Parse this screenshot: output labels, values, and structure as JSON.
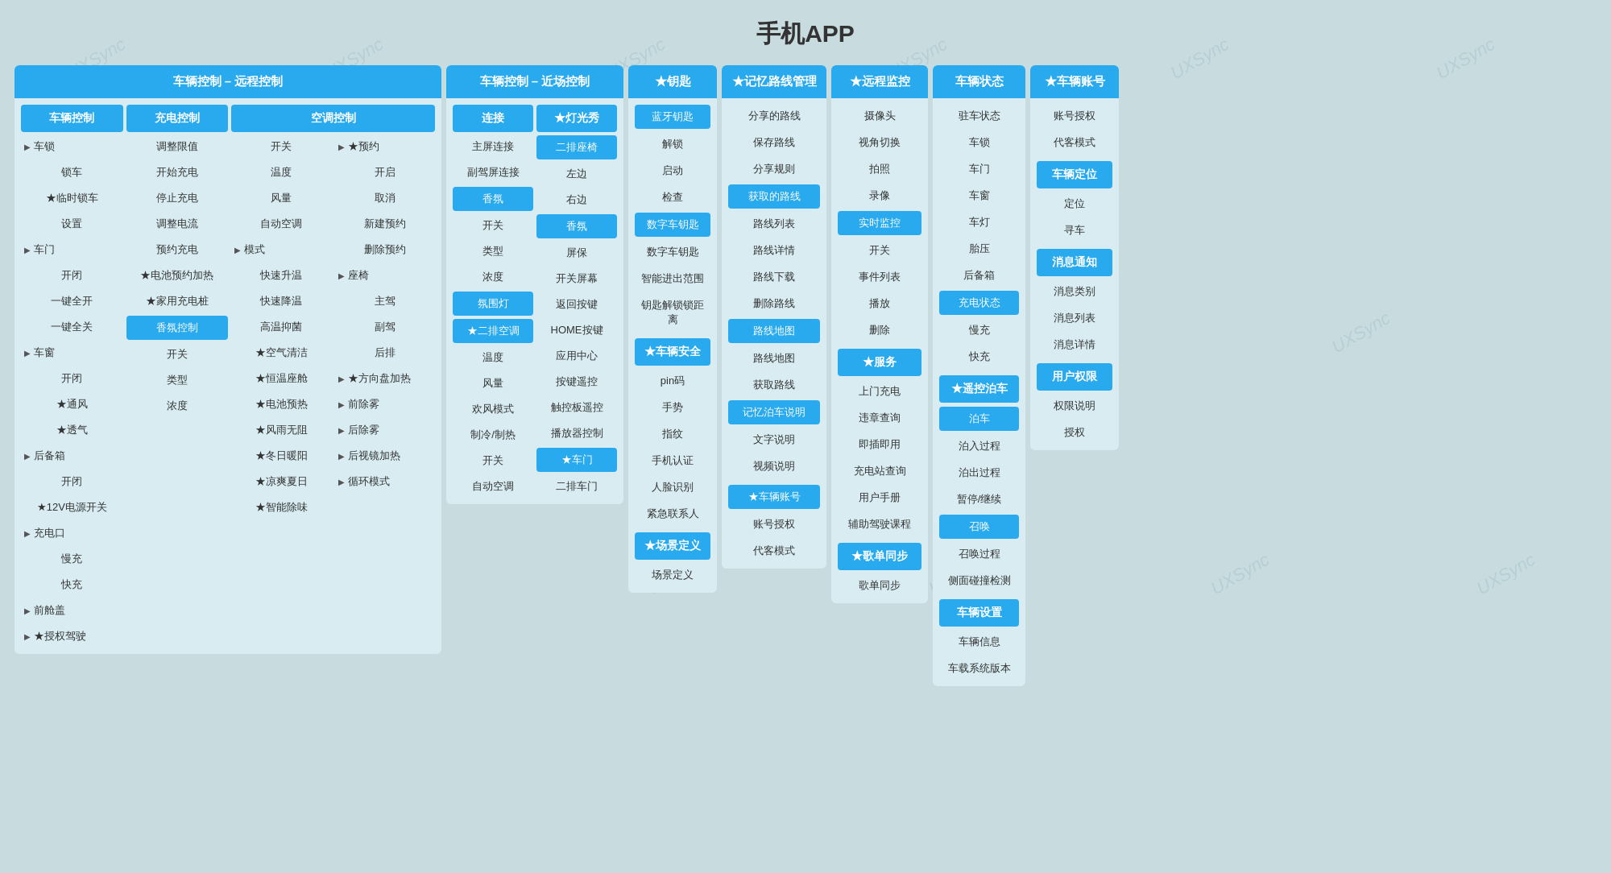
{
  "page": {
    "title": "手机APP"
  },
  "remote_control": {
    "title": "车辆控制 – 远程控制",
    "vehicle_ctrl": {
      "header": "车辆控制",
      "items": [
        {
          "label": "车锁",
          "type": "arrow-group"
        },
        {
          "label": "锁车",
          "type": "item"
        },
        {
          "label": "★临时锁车",
          "type": "item"
        },
        {
          "label": "设置",
          "type": "item"
        },
        {
          "label": "车门",
          "type": "arrow-group"
        },
        {
          "label": "开闭",
          "type": "item"
        },
        {
          "label": "一键全开",
          "type": "item"
        },
        {
          "label": "一键全关",
          "type": "item"
        },
        {
          "label": "车窗",
          "type": "arrow-group"
        },
        {
          "label": "开闭",
          "type": "item"
        },
        {
          "label": "★通风",
          "type": "item"
        },
        {
          "label": "★透气",
          "type": "item"
        },
        {
          "label": "后备箱",
          "type": "arrow-group"
        },
        {
          "label": "开闭",
          "type": "item"
        },
        {
          "label": "★12V电源开关",
          "type": "item"
        },
        {
          "label": "充电口",
          "type": "arrow-group"
        },
        {
          "label": "慢充",
          "type": "item"
        },
        {
          "label": "快充",
          "type": "item"
        },
        {
          "label": "前舱盖",
          "type": "arrow-group"
        },
        {
          "label": "★授权驾驶",
          "type": "arrow-group"
        }
      ]
    },
    "charge_ctrl": {
      "header": "充电控制",
      "items": [
        {
          "label": "调整限值",
          "type": "item"
        },
        {
          "label": "开始充电",
          "type": "item"
        },
        {
          "label": "停止充电",
          "type": "item"
        },
        {
          "label": "调整电流",
          "type": "item"
        },
        {
          "label": "预约充电",
          "type": "item"
        },
        {
          "label": "★电池预约加热",
          "type": "item"
        },
        {
          "label": "★家用充电桩",
          "type": "item"
        },
        {
          "label": "香氛控制",
          "type": "btn-blue"
        },
        {
          "label": "开关",
          "type": "item"
        },
        {
          "label": "类型",
          "type": "item"
        },
        {
          "label": "浓度",
          "type": "item"
        }
      ]
    },
    "aircon_ctrl": {
      "header": "空调控制",
      "sub_items_top": [
        {
          "label": "开关",
          "type": "item"
        },
        {
          "label": "温度",
          "type": "item"
        },
        {
          "label": "风量",
          "type": "item"
        },
        {
          "label": "自动空调",
          "type": "item"
        }
      ],
      "mode": {
        "header": "模式",
        "items": [
          {
            "label": "快速升温",
            "type": "item"
          },
          {
            "label": "快速降温",
            "type": "item"
          },
          {
            "label": "高温抑菌",
            "type": "item"
          },
          {
            "label": "★空气清洁",
            "type": "item"
          },
          {
            "label": "★恒温座舱",
            "type": "item"
          },
          {
            "label": "★电池预热",
            "type": "item"
          },
          {
            "label": "★风雨无阻",
            "type": "item"
          },
          {
            "label": "★冬日暖阳",
            "type": "item"
          },
          {
            "label": "★凉爽夏日",
            "type": "item"
          },
          {
            "label": "★智能除味",
            "type": "item"
          }
        ]
      },
      "yuyue": {
        "header": "★预约",
        "items": [
          {
            "label": "开启",
            "type": "item"
          },
          {
            "label": "取消",
            "type": "item"
          },
          {
            "label": "新建预约",
            "type": "item"
          },
          {
            "label": "删除预约",
            "type": "item"
          }
        ]
      },
      "zuoyi": {
        "header": "座椅",
        "items": [
          {
            "label": "主驾",
            "type": "item"
          },
          {
            "label": "副驾",
            "type": "item"
          },
          {
            "label": "后排",
            "type": "item"
          }
        ]
      },
      "fangxiang": {
        "header": "★方向盘加热"
      },
      "qianwu": {
        "header": "前除雾"
      },
      "houwu": {
        "header": "后除雾"
      },
      "houjing": {
        "header": "后视镜加热"
      },
      "xunhuan": {
        "header": "循环模式"
      }
    }
  },
  "near_control": {
    "title": "车辆控制 – 近场控制",
    "lian_jie": {
      "header": "连接",
      "items": [
        {
          "label": "主屏连接",
          "type": "item"
        },
        {
          "label": "副驾屏连接",
          "type": "item"
        },
        {
          "label": "香氛",
          "type": "btn-blue"
        },
        {
          "label": "开关",
          "type": "item"
        },
        {
          "label": "类型",
          "type": "item"
        },
        {
          "label": "浓度",
          "type": "item"
        },
        {
          "label": "氛围灯",
          "type": "btn-blue"
        },
        {
          "label": "★二排空调",
          "type": "btn-blue"
        },
        {
          "label": "温度",
          "type": "item"
        },
        {
          "label": "风量",
          "type": "item"
        },
        {
          "label": "欢风模式",
          "type": "item"
        },
        {
          "label": "制冷/制热",
          "type": "item"
        },
        {
          "label": "开关",
          "type": "item"
        },
        {
          "label": "自动空调",
          "type": "item"
        }
      ]
    },
    "guangxiu": {
      "header": "★灯光秀",
      "items": [
        {
          "label": "二排座椅",
          "type": "btn-blue"
        },
        {
          "label": "左边",
          "type": "item"
        },
        {
          "label": "右边",
          "type": "item"
        },
        {
          "label": "香氛",
          "type": "btn-blue"
        },
        {
          "label": "屏保",
          "type": "item"
        },
        {
          "label": "开关屏幕",
          "type": "item"
        },
        {
          "label": "返回按键",
          "type": "item"
        },
        {
          "label": "HOME按键",
          "type": "item"
        },
        {
          "label": "应用中心",
          "type": "item"
        },
        {
          "label": "按键遥控",
          "type": "item"
        },
        {
          "label": "触控板遥控",
          "type": "item"
        },
        {
          "label": "播放器控制",
          "type": "item"
        },
        {
          "label": "★车门",
          "type": "btn-blue"
        },
        {
          "label": "二排车门",
          "type": "item"
        }
      ]
    }
  },
  "keys": {
    "title": "★钥匙",
    "bluetooth_key": {
      "label": "蓝牙钥匙",
      "type": "btn-blue"
    },
    "items_bt": [
      {
        "label": "解锁"
      },
      {
        "label": "启动"
      },
      {
        "label": "检查"
      }
    ],
    "digital_key": {
      "label": "数字车钥匙",
      "type": "btn-blue"
    },
    "items_dk": [
      {
        "label": "数字车钥匙"
      },
      {
        "label": "智能进出范围"
      },
      {
        "label": "钥匙解锁锁距离"
      }
    ],
    "vehicle_security": {
      "label": "★车辆安全",
      "type": "section-header"
    },
    "items_vs": [
      {
        "label": "pin码"
      },
      {
        "label": "手势"
      },
      {
        "label": "指纹"
      },
      {
        "label": "手机认证"
      },
      {
        "label": "人脸识别"
      },
      {
        "label": "紧急联系人"
      }
    ],
    "scene": {
      "label": "★场景定义",
      "type": "section-header"
    },
    "items_scene": [
      {
        "label": "场景定义"
      }
    ]
  },
  "route_mgmt": {
    "title": "★记忆路线管理",
    "shared_route": {
      "items": [
        {
          "label": "分享的路线"
        },
        {
          "label": "保存路线"
        },
        {
          "label": "分享规则"
        }
      ]
    },
    "get_route": {
      "header": "获取的路线",
      "items": [
        {
          "label": "路线列表"
        },
        {
          "label": "路线详情"
        },
        {
          "label": "路线下载"
        },
        {
          "label": "删除路线"
        }
      ]
    },
    "route_map": {
      "header": "路线地图",
      "items": [
        {
          "label": "路线地图"
        },
        {
          "label": "获取路线"
        }
      ]
    },
    "memory_drive": {
      "header": "记忆泊车说明",
      "items": [
        {
          "label": "文字说明"
        },
        {
          "label": "视频说明"
        }
      ]
    },
    "vehicle_account2": {
      "header": "★车辆账号",
      "items": [
        {
          "label": "账号授权"
        },
        {
          "label": "代客模式"
        }
      ]
    }
  },
  "remote_monitor": {
    "title": "★远程监控",
    "items_top": [
      {
        "label": "摄像头"
      },
      {
        "label": "视角切换"
      },
      {
        "label": "拍照"
      },
      {
        "label": "录像"
      }
    ],
    "realtime": {
      "label": "实时监控",
      "type": "btn-blue"
    },
    "items_realtime": [
      {
        "label": "开关"
      },
      {
        "label": "事件列表"
      },
      {
        "label": "播放"
      },
      {
        "label": "删除"
      }
    ],
    "service": {
      "label": "★服务",
      "type": "section-header"
    },
    "items_service": [
      {
        "label": "上门充电"
      },
      {
        "label": "违章查询"
      },
      {
        "label": "即插即用"
      },
      {
        "label": "充电站查询"
      },
      {
        "label": "用户手册"
      },
      {
        "label": "辅助驾驶课程"
      }
    ],
    "song_sync": {
      "label": "★歌单同步",
      "type": "section-header"
    },
    "items_song": [
      {
        "label": "歌单同步"
      }
    ]
  },
  "vehicle_status": {
    "title": "车辆状态",
    "items": [
      {
        "label": "驻车状态"
      },
      {
        "label": "车锁"
      },
      {
        "label": "车门"
      },
      {
        "label": "车窗"
      },
      {
        "label": "车灯"
      },
      {
        "label": "胎压"
      },
      {
        "label": "后备箱"
      }
    ],
    "charge_status": {
      "label": "充电状态",
      "type": "btn-blue"
    },
    "items_charge": [
      {
        "label": "慢充"
      },
      {
        "label": "快充"
      }
    ],
    "remote_park": {
      "label": "★遥控泊车",
      "type": "section-header"
    },
    "items_park": [
      {
        "label": "泊车"
      },
      {
        "label": "泊入过程"
      },
      {
        "label": "泊出过程"
      },
      {
        "label": "暂停/继续"
      },
      {
        "label": "召唤"
      },
      {
        "label": "召唤过程"
      },
      {
        "label": "侧面碰撞检测"
      }
    ],
    "vehicle_settings": {
      "label": "车辆设置",
      "type": "section-header"
    },
    "items_settings": [
      {
        "label": "车辆信息"
      },
      {
        "label": "车载系统版本"
      }
    ]
  },
  "vehicle_account": {
    "title": "★车辆账号",
    "items": [
      {
        "label": "账号授权"
      },
      {
        "label": "代客模式"
      }
    ],
    "vehicle_locate": {
      "label": "车辆定位",
      "type": "section-header"
    },
    "items_locate": [
      {
        "label": "定位"
      },
      {
        "label": "寻车"
      }
    ],
    "msg_notify": {
      "label": "消息通知",
      "type": "section-header"
    },
    "items_msg": [
      {
        "label": "消息类别"
      },
      {
        "label": "消息列表"
      },
      {
        "label": "消息详情"
      }
    ],
    "user_permission": {
      "label": "用户权限",
      "type": "section-header"
    },
    "items_perm": [
      {
        "label": "权限说明"
      },
      {
        "label": "授权"
      }
    ]
  }
}
